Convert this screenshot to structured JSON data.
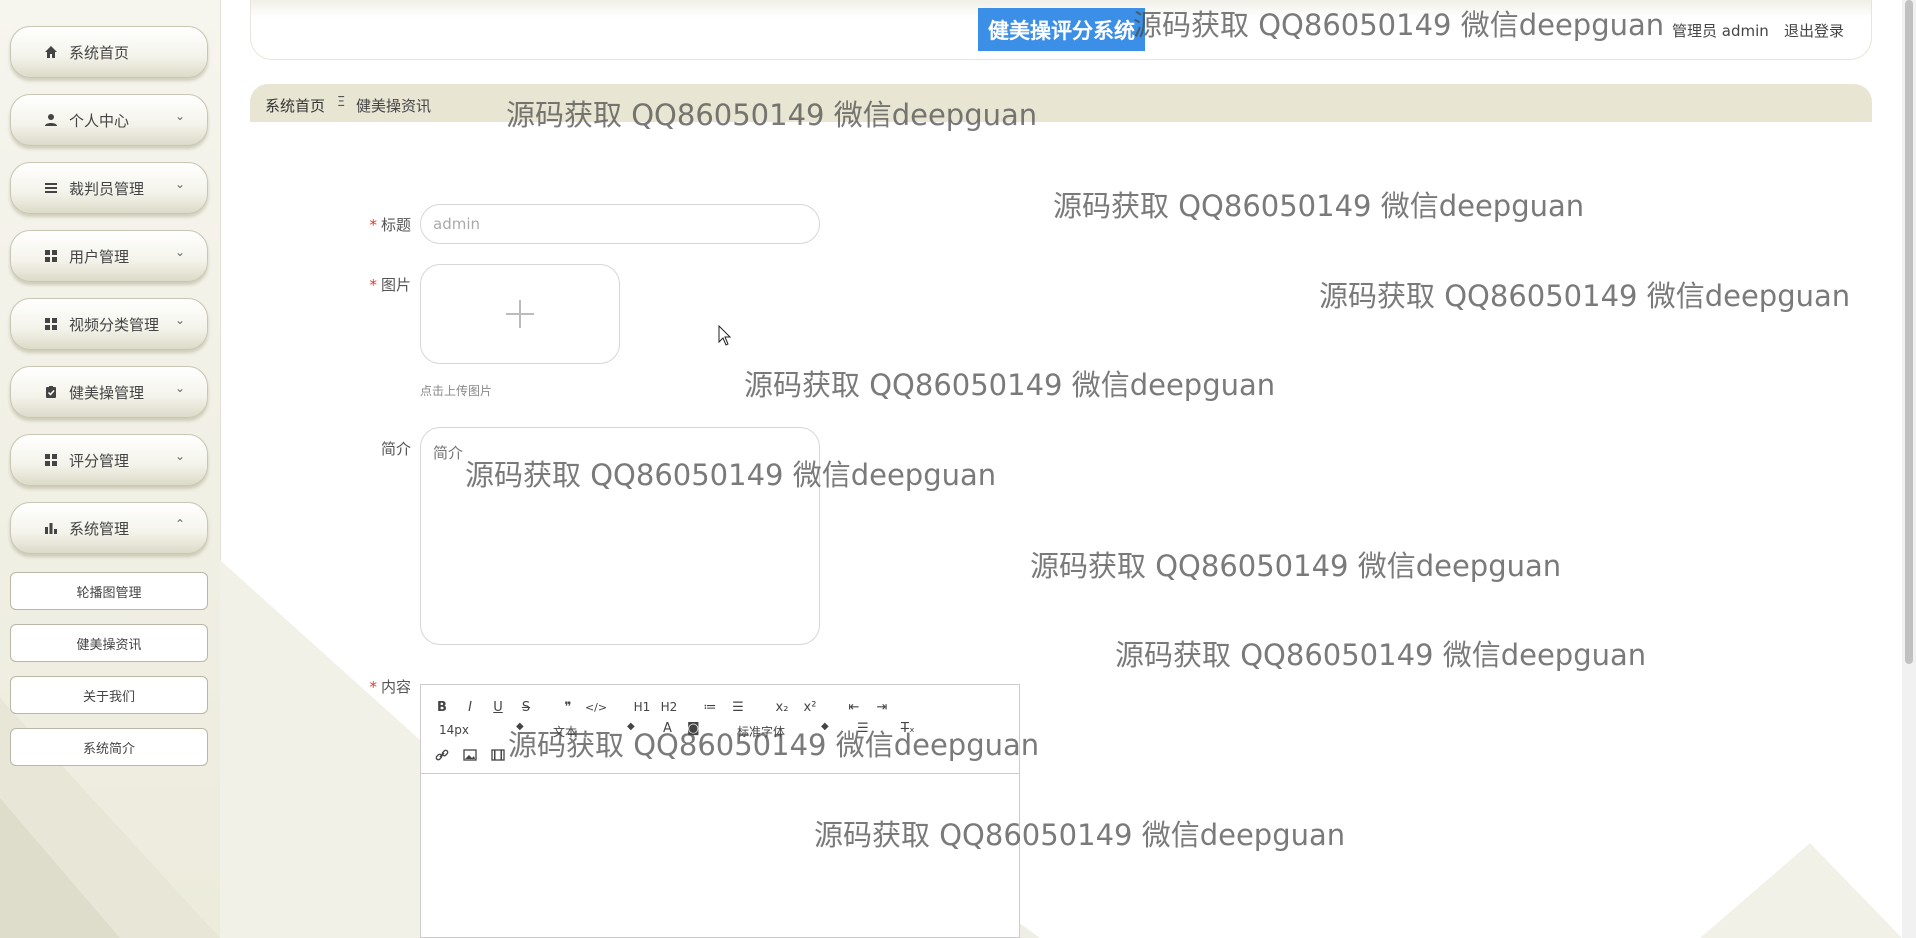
{
  "header": {
    "system_title": "健美操评分系统",
    "user_info": "管理员 admin",
    "logout": "退出登录"
  },
  "sidebar": {
    "items": [
      {
        "label": "系统首页",
        "icon": "home-icon",
        "chevron": ""
      },
      {
        "label": "个人中心",
        "icon": "user-icon",
        "chevron": "⌄"
      },
      {
        "label": "裁判员管理",
        "icon": "list-icon",
        "chevron": "⌄"
      },
      {
        "label": "用户管理",
        "icon": "grid-icon",
        "chevron": "⌄"
      },
      {
        "label": "视频分类管理",
        "icon": "grid-icon",
        "chevron": "⌄"
      },
      {
        "label": "健美操管理",
        "icon": "clipboard-icon",
        "chevron": "⌄"
      },
      {
        "label": "评分管理",
        "icon": "grid-icon",
        "chevron": "⌄"
      },
      {
        "label": "系统管理",
        "icon": "bar-chart-icon",
        "chevron": "⌃"
      }
    ],
    "sub_items": [
      "轮播图管理",
      "健美操资讯",
      "关于我们",
      "系统简介"
    ]
  },
  "breadcrumb": {
    "home": "系统首页",
    "separator": "Ξ",
    "current": "健美操资讯"
  },
  "form": {
    "title_label": "标题",
    "title_value": "admin",
    "image_label": "图片",
    "image_hint": "点击上传图片",
    "intro_label": "简介",
    "intro_placeholder": "简介",
    "content_label": "内容",
    "required_mark": "*"
  },
  "editor": {
    "buttons_row1": [
      "B",
      "I",
      "U",
      "S",
      "❞",
      "</>",
      "H1",
      "H2",
      "≔",
      "☰",
      "x₂",
      "x²",
      "⇤",
      "⇥"
    ],
    "font_size": "14px",
    "text_style": "文本",
    "font_family": "标准字体"
  },
  "watermark": "源码获取 QQ86050149 微信deepguan",
  "colors": {
    "accent": "#3c8fe6",
    "sidebar_bg": "#f1f0e6",
    "crumb_bg": "#e8e5d3",
    "required": "#e0392b"
  }
}
